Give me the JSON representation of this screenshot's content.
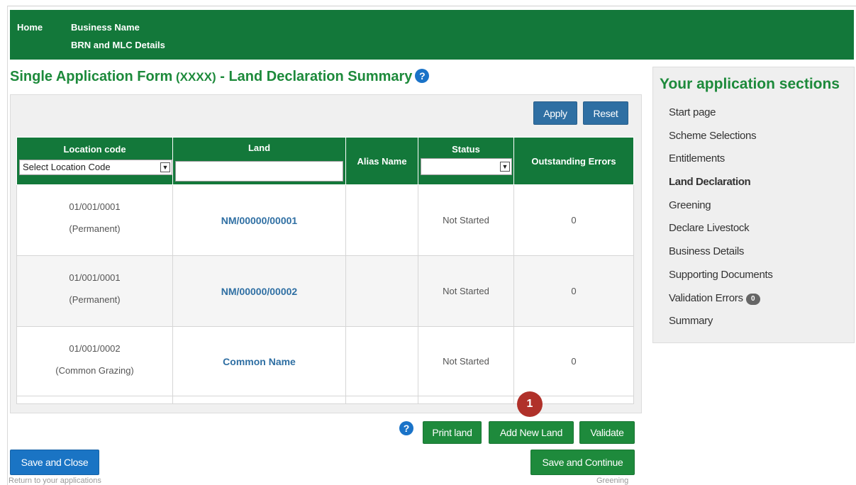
{
  "header": {
    "home": "Home",
    "business_name": "Business Name",
    "brn_mlc": "BRN and MLC Details"
  },
  "page": {
    "title_main": "Single Application Form",
    "title_code": " (XXXX)",
    "title_suffix": " - Land Declaration Summary",
    "help": "?"
  },
  "filters": {
    "apply_label": "Apply",
    "reset_label": "Reset",
    "location_placeholder": "Select Location Code",
    "land_value": "",
    "status_value": ""
  },
  "table": {
    "headers": {
      "location_code": "Location code",
      "land": "Land",
      "alias_name": "Alias Name",
      "status": "Status",
      "outstanding_errors": "Outstanding Errors"
    },
    "rows": [
      {
        "location_code": "01/001/0001",
        "location_type": "(Permanent)",
        "land": "NM/00000/00001",
        "alias": "",
        "status": "Not Started",
        "errors": "0"
      },
      {
        "location_code": "01/001/0001",
        "location_type": "(Permanent)",
        "land": "NM/00000/00002",
        "alias": "",
        "status": "Not Started",
        "errors": "0"
      },
      {
        "location_code": "01/001/0002",
        "location_type": "(Common Grazing)",
        "land": "Common Name",
        "alias": "",
        "status": "Not Started",
        "errors": "0"
      }
    ]
  },
  "actions": {
    "print_land": "Print land",
    "add_new_land": "Add New Land",
    "validate": "Validate",
    "save_and_close": "Save and Close",
    "save_and_continue": "Save and Continue",
    "return_hint": "Return to your applications",
    "next_hint": "Greening",
    "marker": "1"
  },
  "sidebar": {
    "title": "Your application sections",
    "items": [
      {
        "label": "Start page"
      },
      {
        "label": "Scheme Selections"
      },
      {
        "label": "Entitlements"
      },
      {
        "label": "Land Declaration"
      },
      {
        "label": "Greening"
      },
      {
        "label": "Declare Livestock"
      },
      {
        "label": "Business Details"
      },
      {
        "label": "Supporting Documents"
      },
      {
        "label": "Validation Errors",
        "badge": "0"
      },
      {
        "label": "Summary"
      }
    ]
  },
  "colors": {
    "brand_green": "#13783a",
    "title_green": "#1d8a3b",
    "primary_blue": "#2f6fa3",
    "marker_red": "#b0312a"
  }
}
